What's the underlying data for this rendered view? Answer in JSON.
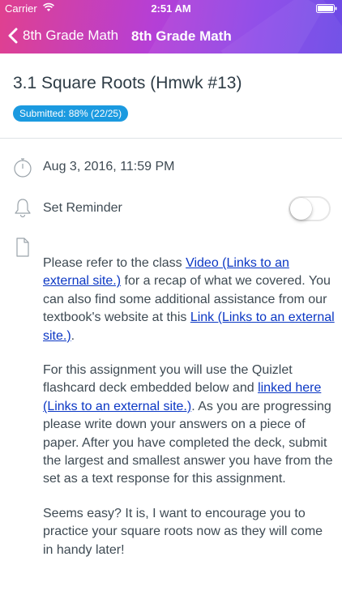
{
  "status_bar": {
    "carrier": "Carrier",
    "time": "2:51 AM"
  },
  "nav": {
    "back_label": "8th Grade Math",
    "title": "8th Grade Math"
  },
  "assignment": {
    "title": "3.1 Square Roots (Hmwk #13)",
    "status": "Submitted: 88% (22/25)",
    "due_date": "Aug 3, 2016, 11:59 PM",
    "reminder_label": "Set Reminder",
    "reminder_on": false
  },
  "description": {
    "p1": {
      "t1": "Please refer to the class ",
      "link1": "Video (Links to an external site.)",
      "t2": " for a recap of what we covered. You can also find some additional assistance from our textbook's website at this ",
      "link2": "Link (Links to an external site.)",
      "t3": "."
    },
    "p2": {
      "t1": "For this assignment you will use the Quizlet flashcard deck embedded below and ",
      "link1": "linked here (Links to an external site.)",
      "t2": ".  As you are progressing please write down your answers on a piece of paper.  After you have completed the deck, submit the largest and smallest answer you have from the set as a text response for this assignment."
    },
    "p3": {
      "t1": "Seems easy?  It is, I want to encourage you to practice your square roots now as they will come in handy later!"
    }
  },
  "colors": {
    "badge": "#1b9ae0",
    "link": "#0b37c4",
    "header_start": "#e0408f",
    "header_end": "#6b4ae6"
  },
  "icons": {
    "back": "chevron-left-icon",
    "due": "stopwatch-icon",
    "reminder": "bell-icon",
    "description": "document-icon"
  }
}
